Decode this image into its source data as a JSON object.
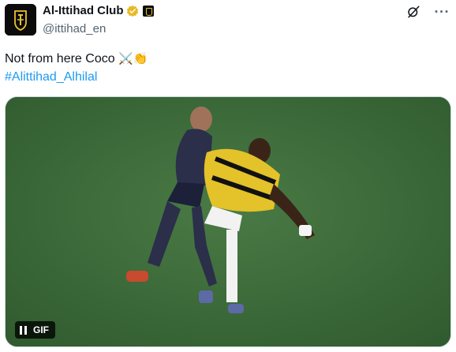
{
  "author": {
    "display_name": "Al-Ittihad Club",
    "handle": "@ittihad_en",
    "verified": true,
    "avatar_icon": "club-crest-icon",
    "affiliate_badge_icon": "club-affiliate-badge-icon"
  },
  "top_actions": {
    "grok_icon": "grok-icon",
    "more_label": "···"
  },
  "tweet": {
    "text": "Not from here Coco",
    "emojis": "⚔️👏",
    "hashtag": "#Alittihad_Alhilal"
  },
  "media": {
    "type": "gif",
    "description_icon": "football-match-gif",
    "badge_label": "GIF",
    "playback_icon": "pause-icon"
  },
  "colors": {
    "text_primary": "#0f1419",
    "text_secondary": "#536471",
    "link": "#1d9bf0",
    "verified_gold": "#e8b923",
    "pitch": "#3d6b3a"
  }
}
